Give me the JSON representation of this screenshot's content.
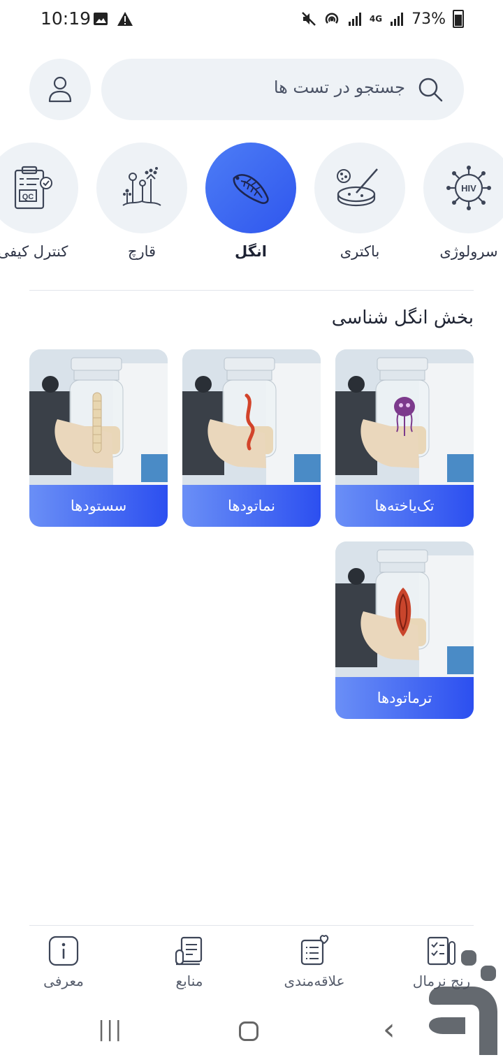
{
  "status_bar": {
    "time": "10:19",
    "battery": "73%",
    "network": "4G"
  },
  "search": {
    "placeholder": "جستجو در تست ها",
    "icon": "search-icon"
  },
  "profile": {
    "icon": "user-icon"
  },
  "categories": [
    {
      "label": "سرولوژی",
      "icon": "virus-hiv-icon",
      "icon_text": "HIV",
      "active": false
    },
    {
      "label": "باکتری",
      "icon": "petri-dish-icon",
      "active": false
    },
    {
      "label": "انگل",
      "icon": "parasite-icon",
      "active": true
    },
    {
      "label": "قارچ",
      "icon": "fungi-icon",
      "active": false
    },
    {
      "label": "کنترل کیفی",
      "icon": "qc-clipboard-icon",
      "icon_text": "QC",
      "active": false
    }
  ],
  "section": {
    "title": "بخش انگل شناسی"
  },
  "cards": [
    {
      "label": "تک‌یاخته‌ها",
      "specimen": "protozoa",
      "specimen_color": "#7c3a8c"
    },
    {
      "label": "نماتودها",
      "specimen": "nematode",
      "specimen_color": "#d2432a"
    },
    {
      "label": "سستودها",
      "specimen": "cestode",
      "specimen_color": "#e8d6b0"
    },
    {
      "label": "ترماتودها",
      "specimen": "trematode",
      "specimen_color": "#c9452c"
    }
  ],
  "bottom_nav": [
    {
      "label": "رنج نرمال",
      "icon": "checklist-tube-icon"
    },
    {
      "label": "علاقه‌مندی",
      "icon": "favorites-list-icon"
    },
    {
      "label": "منابع",
      "icon": "references-icon"
    },
    {
      "label": "معرفی",
      "icon": "info-icon"
    }
  ],
  "system_nav": {
    "recents": "|||",
    "back": "‹"
  },
  "colors": {
    "accent": "#3b63f0",
    "surface": "#eef2f6",
    "text": "#2b3142"
  }
}
